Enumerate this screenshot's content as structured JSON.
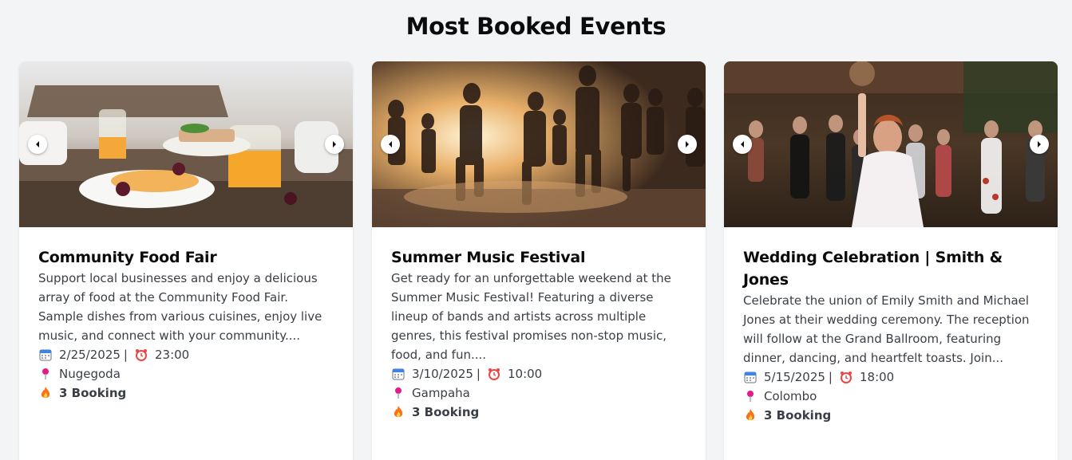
{
  "section": {
    "title": "Most Booked Events"
  },
  "events": [
    {
      "title": "Community Food Fair",
      "description": "Support local businesses and enjoy a delicious array of food at the Community Food Fair. Sample dishes from various cuisines, enjoy live music, and connect with your community....",
      "date": "2/25/2025",
      "separator": "|",
      "time": "23:00",
      "location": "Nugegoda",
      "bookings": "3 Booking",
      "image_theme": "food-table-photo"
    },
    {
      "title": "Summer Music Festival",
      "description": "Get ready for an unforgettable weekend at the Summer Music Festival! Featuring a diverse lineup of bands and artists across multiple genres, this festival promises non-stop music, food, and fun....",
      "date": "3/10/2025",
      "separator": "|",
      "time": "10:00",
      "location": "Gampaha",
      "bookings": "3 Booking",
      "image_theme": "festival-crowd-photo"
    },
    {
      "title": "Wedding Celebration | Smith & Jones",
      "description": "Celebrate the union of Emily Smith and Michael Jones at their wedding ceremony. The reception will follow at the Grand Ballroom, featuring dinner, dancing, and heartfelt toasts. Join...",
      "date": "5/15/2025",
      "separator": "|",
      "time": "18:00",
      "location": "Colombo",
      "bookings": "3 Booking",
      "image_theme": "wedding-bouquet-photo"
    }
  ],
  "icons": {
    "prev": "chevron-left-icon",
    "next": "chevron-right-icon",
    "date": "calendar-icon",
    "time": "alarm-clock-icon",
    "location": "map-pin-icon",
    "bookings": "fire-icon"
  },
  "colors": {
    "page_background": "#f3f4f6",
    "card_background": "#ffffff",
    "title_text": "#0b0b0b",
    "body_text": "#3a3f47",
    "pin": "#e6198a",
    "fire": "#f97316",
    "alarm": "#ef4444",
    "calendar": "#3b82f6"
  }
}
